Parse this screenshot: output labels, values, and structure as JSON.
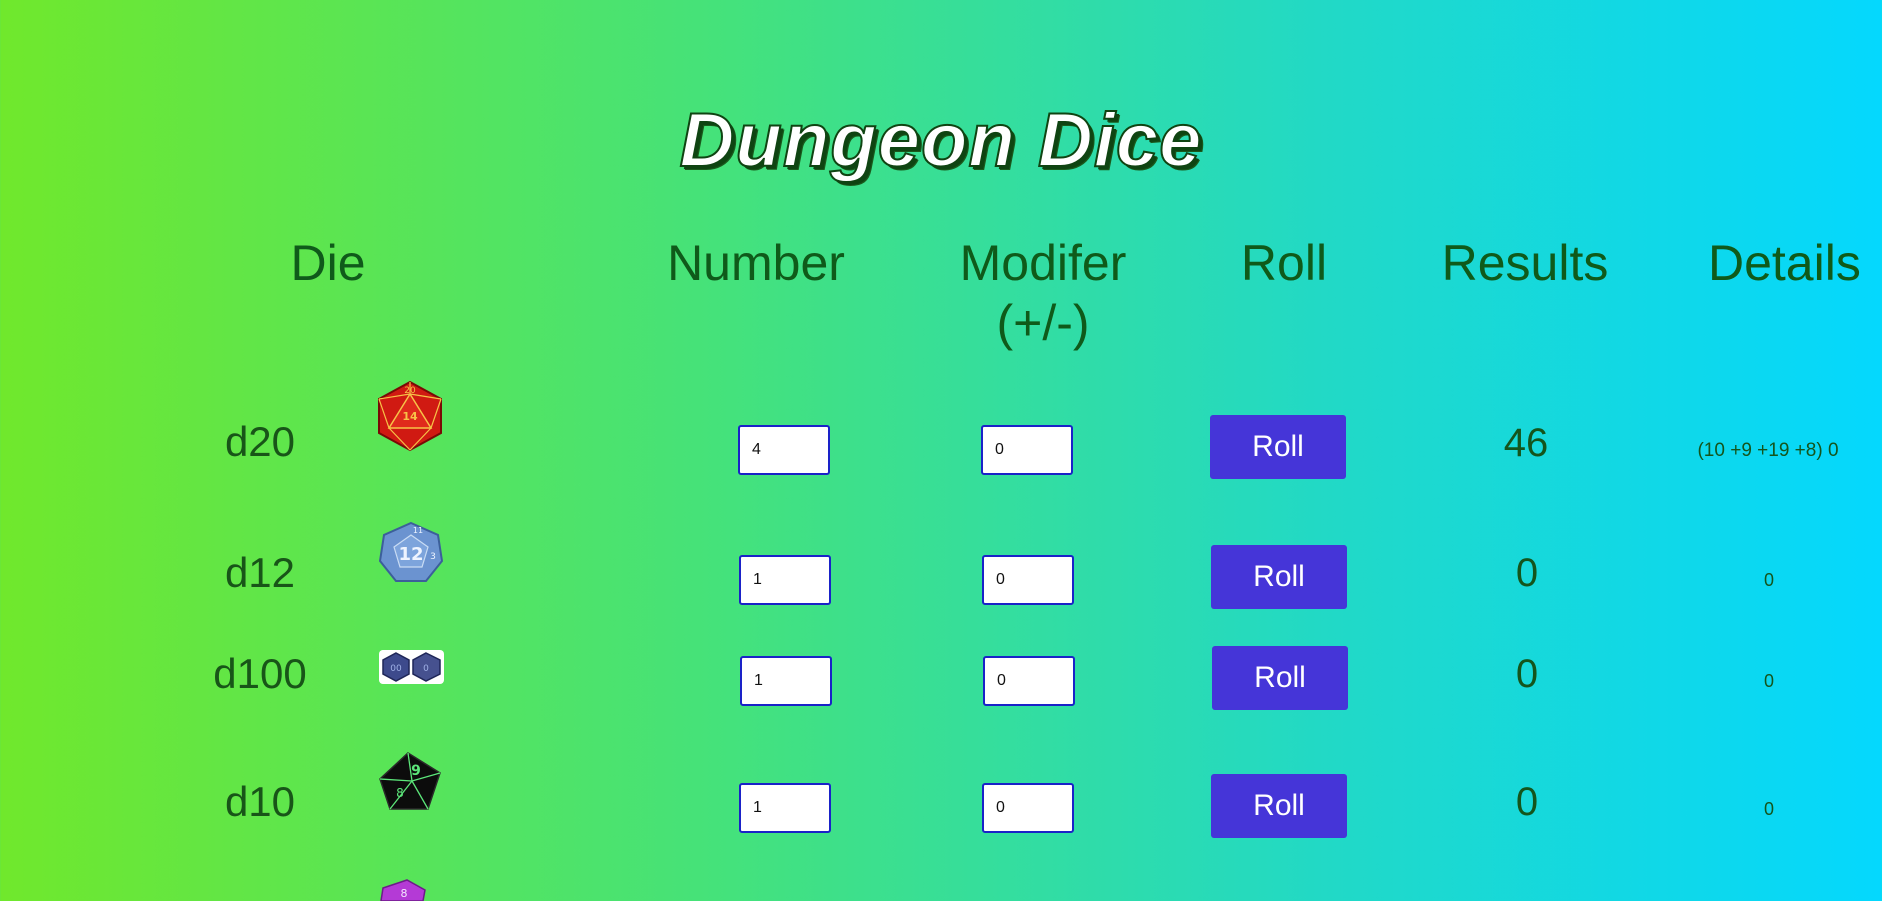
{
  "app": {
    "title": "Dungeon Dice"
  },
  "headers": {
    "die": "Die",
    "number": "Number",
    "modifier_line1": "Modifer",
    "modifier_line2": "(+/-)",
    "roll": "Roll",
    "results": "Results",
    "details": "Details"
  },
  "rows": [
    {
      "die": "d20",
      "icon": "d20-die-icon",
      "number": "4",
      "modifier": "0",
      "roll_label": "Roll",
      "result": "46",
      "details": "(10 +9 +19 +8) 0"
    },
    {
      "die": "d12",
      "icon": "d12-die-icon",
      "number": "1",
      "modifier": "0",
      "roll_label": "Roll",
      "result": "0",
      "details": "0"
    },
    {
      "die": "d100",
      "icon": "d100-die-icon",
      "number": "1",
      "modifier": "0",
      "roll_label": "Roll",
      "result": "0",
      "details": "0"
    },
    {
      "die": "d10",
      "icon": "d10-die-icon",
      "number": "1",
      "modifier": "0",
      "roll_label": "Roll",
      "result": "0",
      "details": "0"
    }
  ],
  "colors": {
    "gradient_left": "#70e82c",
    "gradient_right": "#04d8fe",
    "button": "#4535d8",
    "text": "#14551c"
  }
}
